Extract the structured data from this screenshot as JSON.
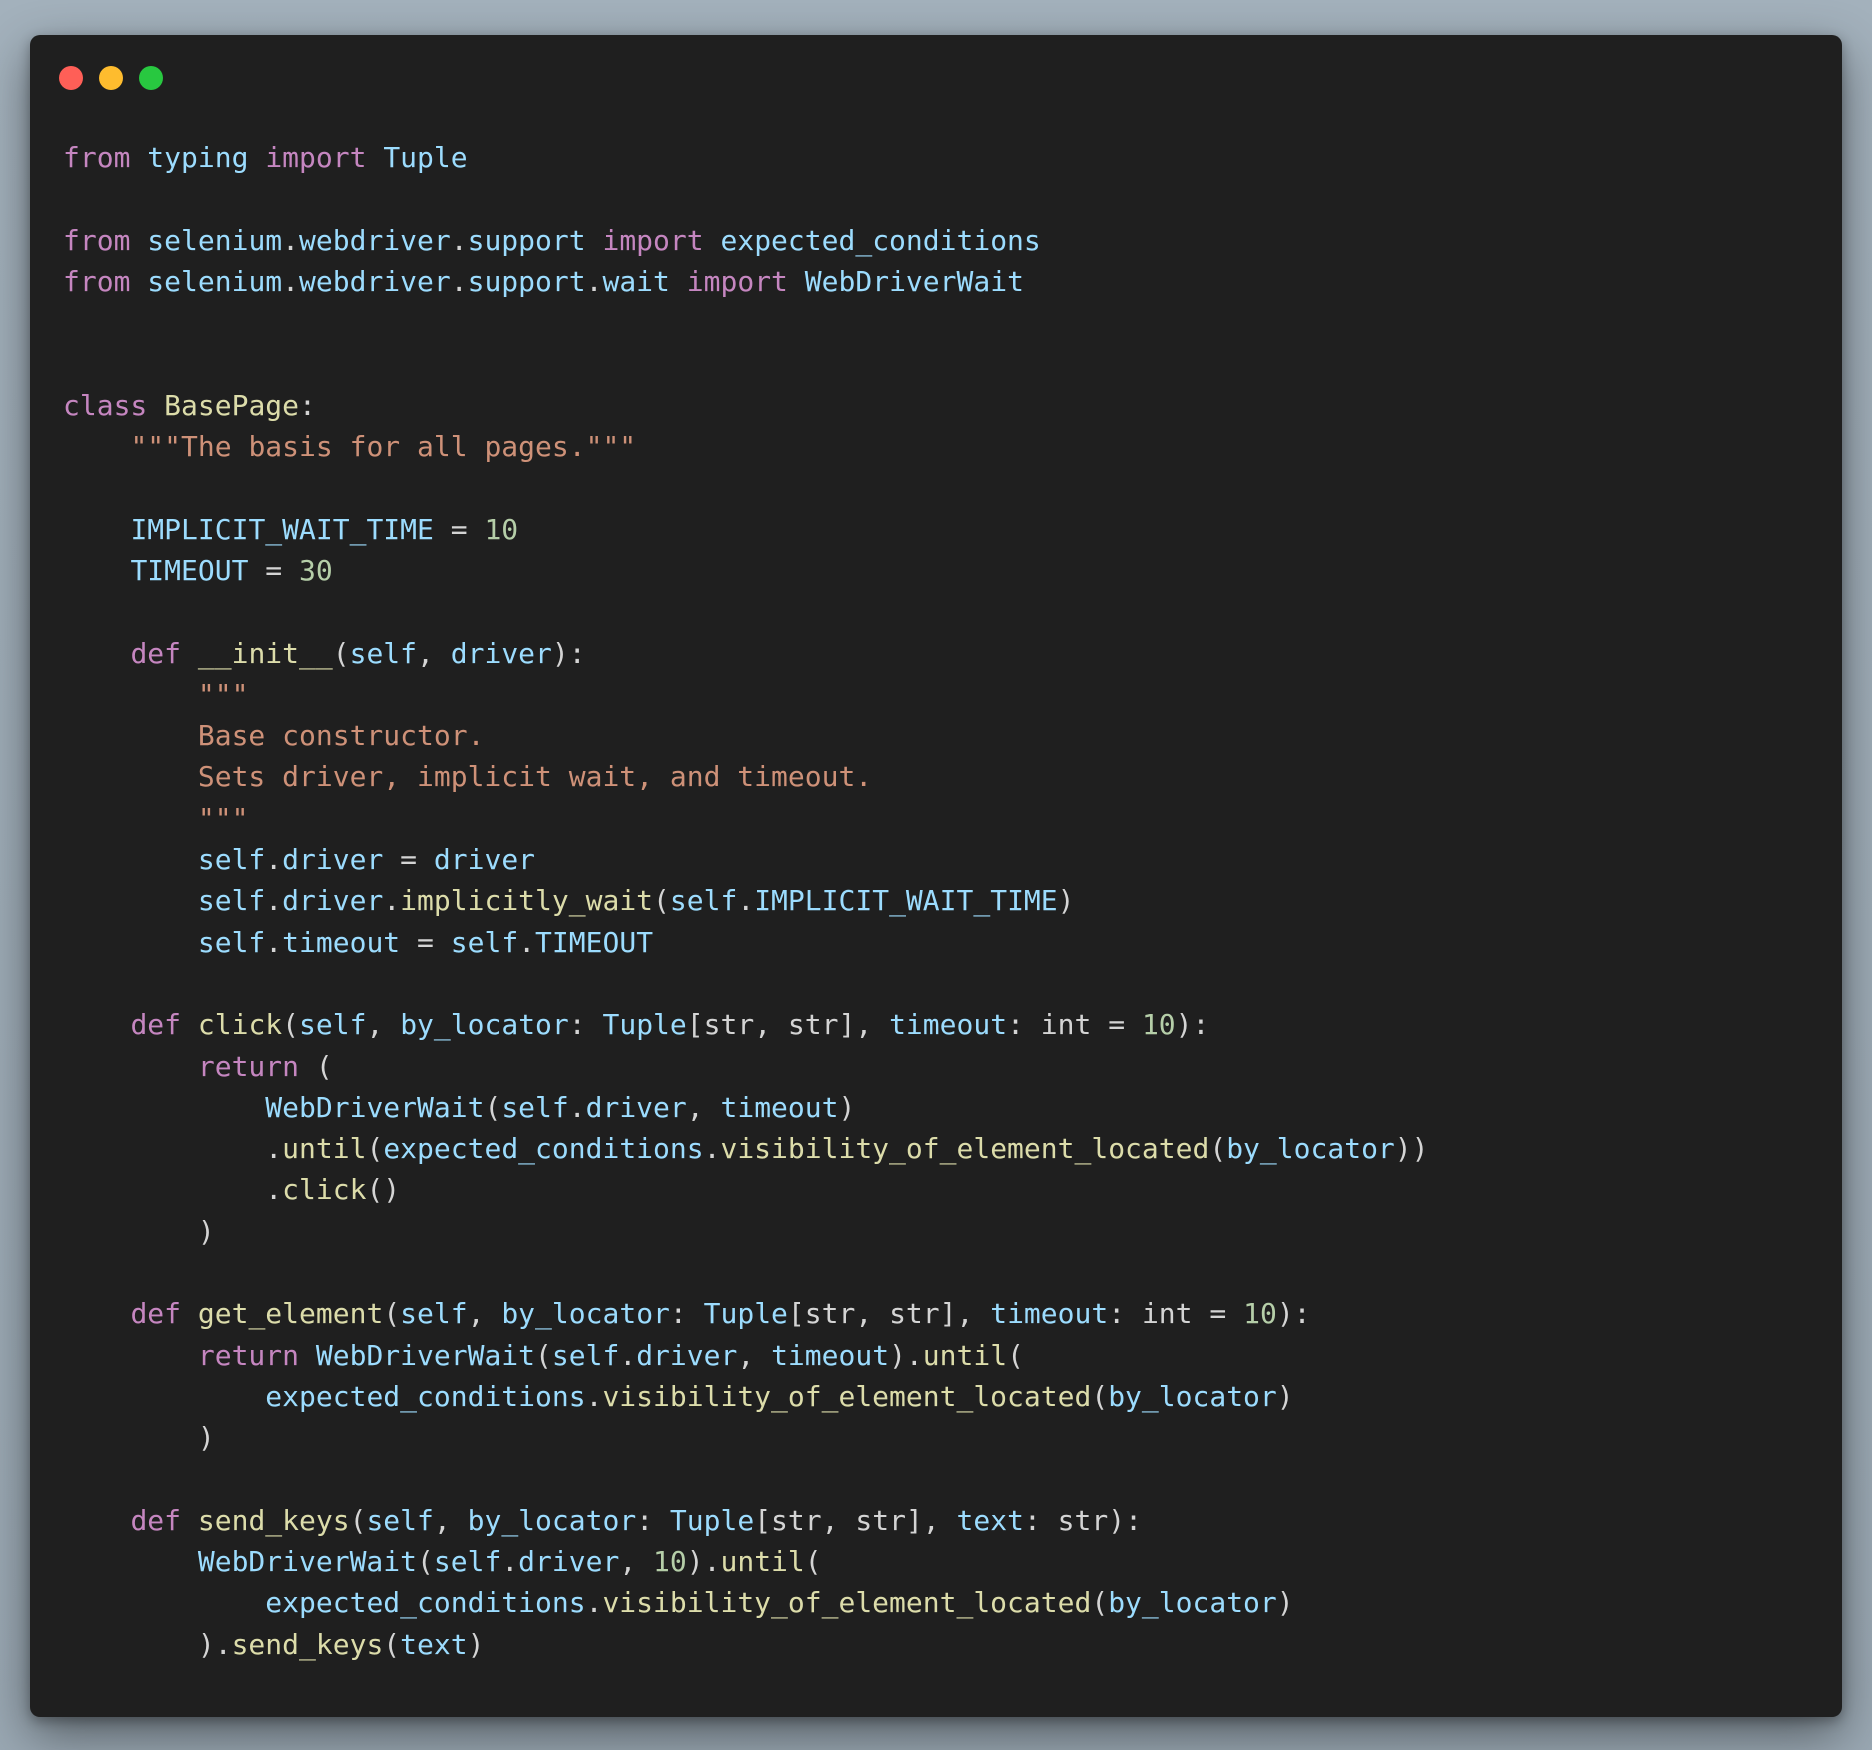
{
  "window": {
    "traffic_lights": [
      {
        "name": "close",
        "color": "#ff5f57"
      },
      {
        "name": "minimize",
        "color": "#febc2e"
      },
      {
        "name": "maximize",
        "color": "#28c840"
      }
    ]
  },
  "colors": {
    "keyword": "#c586c0",
    "variable": "#9cdcfe",
    "function": "#dcdcaa",
    "string": "#ce9178",
    "number": "#b5cea8",
    "class": "#4ec9b0",
    "plain": "#d4d4d4"
  },
  "code": {
    "language": "python",
    "lines": [
      [
        [
          "keyword",
          "from"
        ],
        [
          "plain",
          " "
        ],
        [
          "variable",
          "typing"
        ],
        [
          "plain",
          " "
        ],
        [
          "keyword",
          "import"
        ],
        [
          "plain",
          " "
        ],
        [
          "variable",
          "Tuple"
        ]
      ],
      [],
      [
        [
          "keyword",
          "from"
        ],
        [
          "plain",
          " "
        ],
        [
          "variable",
          "selenium"
        ],
        [
          "plain",
          "."
        ],
        [
          "variable",
          "webdriver"
        ],
        [
          "plain",
          "."
        ],
        [
          "variable",
          "support"
        ],
        [
          "plain",
          " "
        ],
        [
          "keyword",
          "import"
        ],
        [
          "plain",
          " "
        ],
        [
          "variable",
          "expected_conditions"
        ]
      ],
      [
        [
          "keyword",
          "from"
        ],
        [
          "plain",
          " "
        ],
        [
          "variable",
          "selenium"
        ],
        [
          "plain",
          "."
        ],
        [
          "variable",
          "webdriver"
        ],
        [
          "plain",
          "."
        ],
        [
          "variable",
          "support"
        ],
        [
          "plain",
          "."
        ],
        [
          "variable",
          "wait"
        ],
        [
          "plain",
          " "
        ],
        [
          "keyword",
          "import"
        ],
        [
          "plain",
          " "
        ],
        [
          "variable",
          "WebDriverWait"
        ]
      ],
      [],
      [],
      [
        [
          "keyword",
          "class"
        ],
        [
          "plain",
          " "
        ],
        [
          "function",
          "BasePage"
        ],
        [
          "plain",
          ":"
        ]
      ],
      [
        [
          "plain",
          "    "
        ],
        [
          "string",
          "\"\"\"The basis for all pages.\"\"\""
        ]
      ],
      [],
      [
        [
          "plain",
          "    "
        ],
        [
          "variable",
          "IMPLICIT_WAIT_TIME"
        ],
        [
          "plain",
          " = "
        ],
        [
          "number",
          "10"
        ]
      ],
      [
        [
          "plain",
          "    "
        ],
        [
          "variable",
          "TIMEOUT"
        ],
        [
          "plain",
          " = "
        ],
        [
          "number",
          "30"
        ]
      ],
      [],
      [
        [
          "plain",
          "    "
        ],
        [
          "keyword",
          "def"
        ],
        [
          "plain",
          " "
        ],
        [
          "function",
          "__init__"
        ],
        [
          "plain",
          "("
        ],
        [
          "variable",
          "self"
        ],
        [
          "plain",
          ", "
        ],
        [
          "variable",
          "driver"
        ],
        [
          "plain",
          "):"
        ]
      ],
      [
        [
          "plain",
          "        "
        ],
        [
          "string",
          "\"\"\""
        ]
      ],
      [
        [
          "plain",
          "        "
        ],
        [
          "string",
          "Base constructor."
        ]
      ],
      [
        [
          "plain",
          "        "
        ],
        [
          "string",
          "Sets driver, implicit wait, and timeout."
        ]
      ],
      [
        [
          "plain",
          "        "
        ],
        [
          "string",
          "\"\"\""
        ]
      ],
      [
        [
          "plain",
          "        "
        ],
        [
          "variable",
          "self"
        ],
        [
          "plain",
          "."
        ],
        [
          "variable",
          "driver"
        ],
        [
          "plain",
          " = "
        ],
        [
          "variable",
          "driver"
        ]
      ],
      [
        [
          "plain",
          "        "
        ],
        [
          "variable",
          "self"
        ],
        [
          "plain",
          "."
        ],
        [
          "variable",
          "driver"
        ],
        [
          "plain",
          "."
        ],
        [
          "function",
          "implicitly_wait"
        ],
        [
          "plain",
          "("
        ],
        [
          "variable",
          "self"
        ],
        [
          "plain",
          "."
        ],
        [
          "variable",
          "IMPLICIT_WAIT_TIME"
        ],
        [
          "plain",
          ")"
        ]
      ],
      [
        [
          "plain",
          "        "
        ],
        [
          "variable",
          "self"
        ],
        [
          "plain",
          "."
        ],
        [
          "variable",
          "timeout"
        ],
        [
          "plain",
          " = "
        ],
        [
          "variable",
          "self"
        ],
        [
          "plain",
          "."
        ],
        [
          "variable",
          "TIMEOUT"
        ]
      ],
      [],
      [
        [
          "plain",
          "    "
        ],
        [
          "keyword",
          "def"
        ],
        [
          "plain",
          " "
        ],
        [
          "function",
          "click"
        ],
        [
          "plain",
          "("
        ],
        [
          "variable",
          "self"
        ],
        [
          "plain",
          ", "
        ],
        [
          "variable",
          "by_locator"
        ],
        [
          "plain",
          ": "
        ],
        [
          "variable",
          "Tuple"
        ],
        [
          "plain",
          "[str, str], "
        ],
        [
          "variable",
          "timeout"
        ],
        [
          "plain",
          ": int = "
        ],
        [
          "number",
          "10"
        ],
        [
          "plain",
          "):"
        ]
      ],
      [
        [
          "plain",
          "        "
        ],
        [
          "keyword",
          "return"
        ],
        [
          "plain",
          " ("
        ]
      ],
      [
        [
          "plain",
          "            "
        ],
        [
          "variable",
          "WebDriverWait"
        ],
        [
          "plain",
          "("
        ],
        [
          "variable",
          "self"
        ],
        [
          "plain",
          "."
        ],
        [
          "variable",
          "driver"
        ],
        [
          "plain",
          ", "
        ],
        [
          "variable",
          "timeout"
        ],
        [
          "plain",
          ")"
        ]
      ],
      [
        [
          "plain",
          "            ."
        ],
        [
          "function",
          "until"
        ],
        [
          "plain",
          "("
        ],
        [
          "variable",
          "expected_conditions"
        ],
        [
          "plain",
          "."
        ],
        [
          "function",
          "visibility_of_element_located"
        ],
        [
          "plain",
          "("
        ],
        [
          "variable",
          "by_locator"
        ],
        [
          "plain",
          "))"
        ]
      ],
      [
        [
          "plain",
          "            ."
        ],
        [
          "function",
          "click"
        ],
        [
          "plain",
          "()"
        ]
      ],
      [
        [
          "plain",
          "        )"
        ]
      ],
      [],
      [
        [
          "plain",
          "    "
        ],
        [
          "keyword",
          "def"
        ],
        [
          "plain",
          " "
        ],
        [
          "function",
          "get_element"
        ],
        [
          "plain",
          "("
        ],
        [
          "variable",
          "self"
        ],
        [
          "plain",
          ", "
        ],
        [
          "variable",
          "by_locator"
        ],
        [
          "plain",
          ": "
        ],
        [
          "variable",
          "Tuple"
        ],
        [
          "plain",
          "[str, str], "
        ],
        [
          "variable",
          "timeout"
        ],
        [
          "plain",
          ": int = "
        ],
        [
          "number",
          "10"
        ],
        [
          "plain",
          "):"
        ]
      ],
      [
        [
          "plain",
          "        "
        ],
        [
          "keyword",
          "return"
        ],
        [
          "plain",
          " "
        ],
        [
          "variable",
          "WebDriverWait"
        ],
        [
          "plain",
          "("
        ],
        [
          "variable",
          "self"
        ],
        [
          "plain",
          "."
        ],
        [
          "variable",
          "driver"
        ],
        [
          "plain",
          ", "
        ],
        [
          "variable",
          "timeout"
        ],
        [
          "plain",
          ")."
        ],
        [
          "function",
          "until"
        ],
        [
          "plain",
          "("
        ]
      ],
      [
        [
          "plain",
          "            "
        ],
        [
          "variable",
          "expected_conditions"
        ],
        [
          "plain",
          "."
        ],
        [
          "function",
          "visibility_of_element_located"
        ],
        [
          "plain",
          "("
        ],
        [
          "variable",
          "by_locator"
        ],
        [
          "plain",
          ")"
        ]
      ],
      [
        [
          "plain",
          "        )"
        ]
      ],
      [],
      [
        [
          "plain",
          "    "
        ],
        [
          "keyword",
          "def"
        ],
        [
          "plain",
          " "
        ],
        [
          "function",
          "send_keys"
        ],
        [
          "plain",
          "("
        ],
        [
          "variable",
          "self"
        ],
        [
          "plain",
          ", "
        ],
        [
          "variable",
          "by_locator"
        ],
        [
          "plain",
          ": "
        ],
        [
          "variable",
          "Tuple"
        ],
        [
          "plain",
          "[str, str], "
        ],
        [
          "variable",
          "text"
        ],
        [
          "plain",
          ": str):"
        ]
      ],
      [
        [
          "plain",
          "        "
        ],
        [
          "variable",
          "WebDriverWait"
        ],
        [
          "plain",
          "("
        ],
        [
          "variable",
          "self"
        ],
        [
          "plain",
          "."
        ],
        [
          "variable",
          "driver"
        ],
        [
          "plain",
          ", "
        ],
        [
          "number",
          "10"
        ],
        [
          "plain",
          ")."
        ],
        [
          "function",
          "until"
        ],
        [
          "plain",
          "("
        ]
      ],
      [
        [
          "plain",
          "            "
        ],
        [
          "variable",
          "expected_conditions"
        ],
        [
          "plain",
          "."
        ],
        [
          "function",
          "visibility_of_element_located"
        ],
        [
          "plain",
          "("
        ],
        [
          "variable",
          "by_locator"
        ],
        [
          "plain",
          ")"
        ]
      ],
      [
        [
          "plain",
          "        )."
        ],
        [
          "function",
          "send_keys"
        ],
        [
          "plain",
          "("
        ],
        [
          "variable",
          "text"
        ],
        [
          "plain",
          ")"
        ]
      ]
    ]
  }
}
